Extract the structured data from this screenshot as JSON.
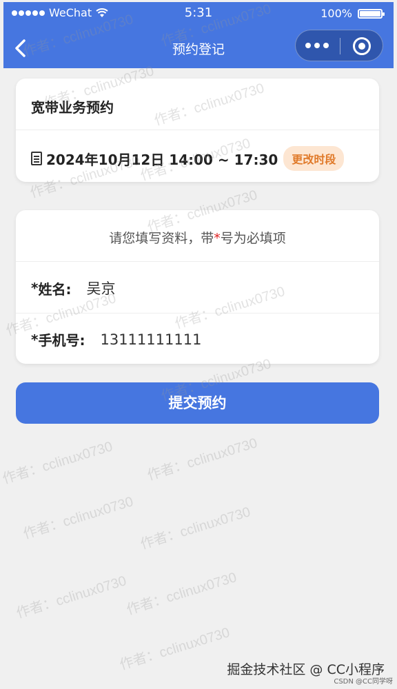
{
  "statusbar": {
    "carrier": "WeChat",
    "time": "5:31",
    "battery": "100%"
  },
  "navbar": {
    "title": "预约登记"
  },
  "booking": {
    "service_title": "宽带业务预约",
    "date_time": "2024年10月12日 14:00 ~ 17:30",
    "change_label": "更改时段"
  },
  "form": {
    "hint_before": "请您填写资料，带",
    "hint_star": "*",
    "hint_after": "号为必填项",
    "required_mark": "*",
    "name_label": "姓名:",
    "name_value": "吴京",
    "phone_label": "手机号:",
    "phone_value": "13111111111"
  },
  "submit_label": "提交预约",
  "watermark_text": "作者：cclinux0730",
  "footer": {
    "source": "掘金技术社区 @ CC小程序",
    "csdn": "CSDN @CC同学呀"
  },
  "colors": {
    "primary": "#4676e0",
    "accent_orange": "#e07a2a",
    "required_red": "#e02020"
  }
}
